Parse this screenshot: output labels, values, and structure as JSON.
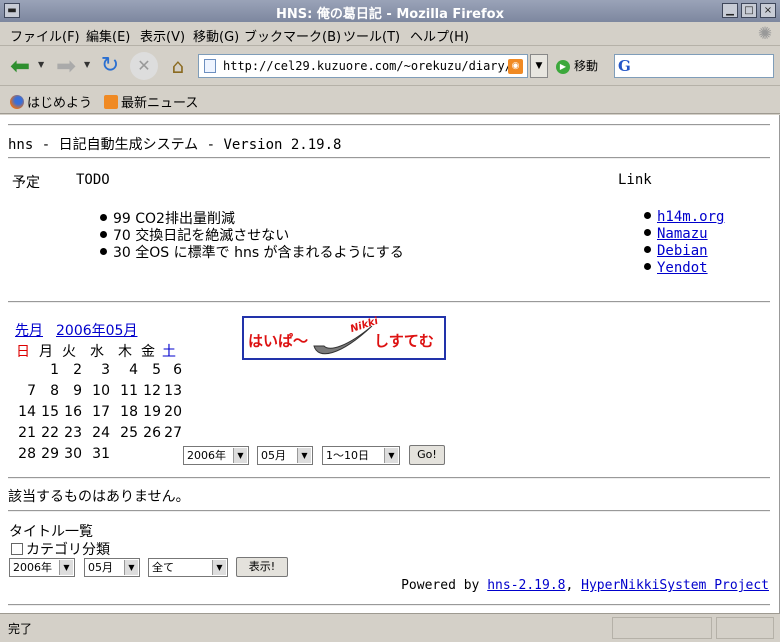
{
  "window": {
    "title": "HNS: 俺の葛日記 - Mozilla Firefox"
  },
  "menubar": {
    "items": [
      "ファイル(F)",
      "編集(E)",
      "表示(V)",
      "移動(G)",
      "ブックマーク(B)",
      "ツール(T)",
      "ヘルプ(H)"
    ]
  },
  "navbar": {
    "url": "http://cel29.kuzuore.com/~orekuzu/diary/",
    "go_label": "移動",
    "search_logo": "G",
    "go_glyph": "▶",
    "dropdown_glyph": "▼"
  },
  "bookmarks": {
    "items": [
      "はじめよう",
      "最新ニュース"
    ]
  },
  "page": {
    "header": "hns - 日記自動生成システム - Version 2.19.8",
    "yotei_label": "予定",
    "todo_label": "TODO",
    "link_label": "Link",
    "todo_items": [
      "99 CO2排出量削減",
      "70 交換日記を絶滅させない",
      "30 全OS に標準で hns が含まれるようにする"
    ],
    "links": [
      "h14m.org",
      "Namazu",
      "Debian",
      "Yendot"
    ],
    "calendar": {
      "prev_link": "先月",
      "month_link": "2006年05月",
      "weekdays": [
        "日",
        "月",
        "火",
        "水",
        "木",
        "金",
        "土"
      ],
      "rows": [
        [
          "",
          "1",
          "2",
          "3",
          "4",
          "5",
          "6"
        ],
        [
          "7",
          "8",
          "9",
          "10",
          "11",
          "12",
          "13"
        ],
        [
          "14",
          "15",
          "16",
          "17",
          "18",
          "19",
          "20"
        ],
        [
          "21",
          "22",
          "23",
          "24",
          "25",
          "26",
          "27"
        ],
        [
          "28",
          "29",
          "30",
          "31",
          "",
          "",
          ""
        ]
      ]
    },
    "logo": {
      "left_text": "はいぱ〜",
      "nikki_text": "Nikki",
      "right_text": "しすてむ"
    },
    "date_selector": {
      "year": "2006年",
      "month": "05月",
      "range": "1〜10日",
      "go": "Go!"
    },
    "no_result": "該当するものはありません。",
    "title_list": {
      "heading": "タイトル一覧",
      "category_label": "カテゴリ分類",
      "year": "2006年",
      "month": "05月",
      "all": "全て",
      "show_button": "表示!"
    },
    "footer": {
      "powered_by": "Powered by",
      "hns_link": "hns-2.19.8",
      "separator": ",",
      "project_link": "HyperNikkiSystem Project"
    }
  },
  "status": {
    "text": "完了"
  },
  "colors": {
    "sunday": "#dd0000",
    "saturday": "#0000cc",
    "link": "#0000cc",
    "logo_red": "#dd1111",
    "logo_border": "#2233aa"
  }
}
